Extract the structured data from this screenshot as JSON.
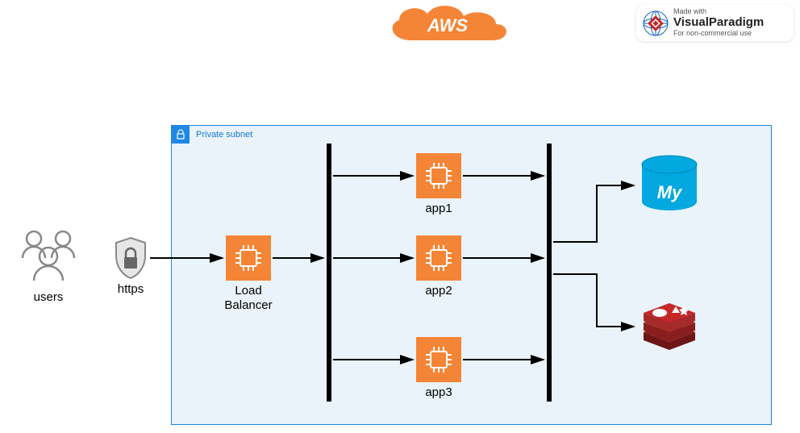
{
  "header": {
    "aws_label": "AWS",
    "watermark_top": "Made with",
    "watermark_brand": "VisualParadigm",
    "watermark_sub": "For non-commercial use"
  },
  "subnet": {
    "label": "Private subnet"
  },
  "nodes": {
    "users": "users",
    "https": "https",
    "load_balancer": "Load Balancer",
    "app1": "app1",
    "app2": "app2",
    "app3": "app3",
    "mysql": "My"
  }
}
